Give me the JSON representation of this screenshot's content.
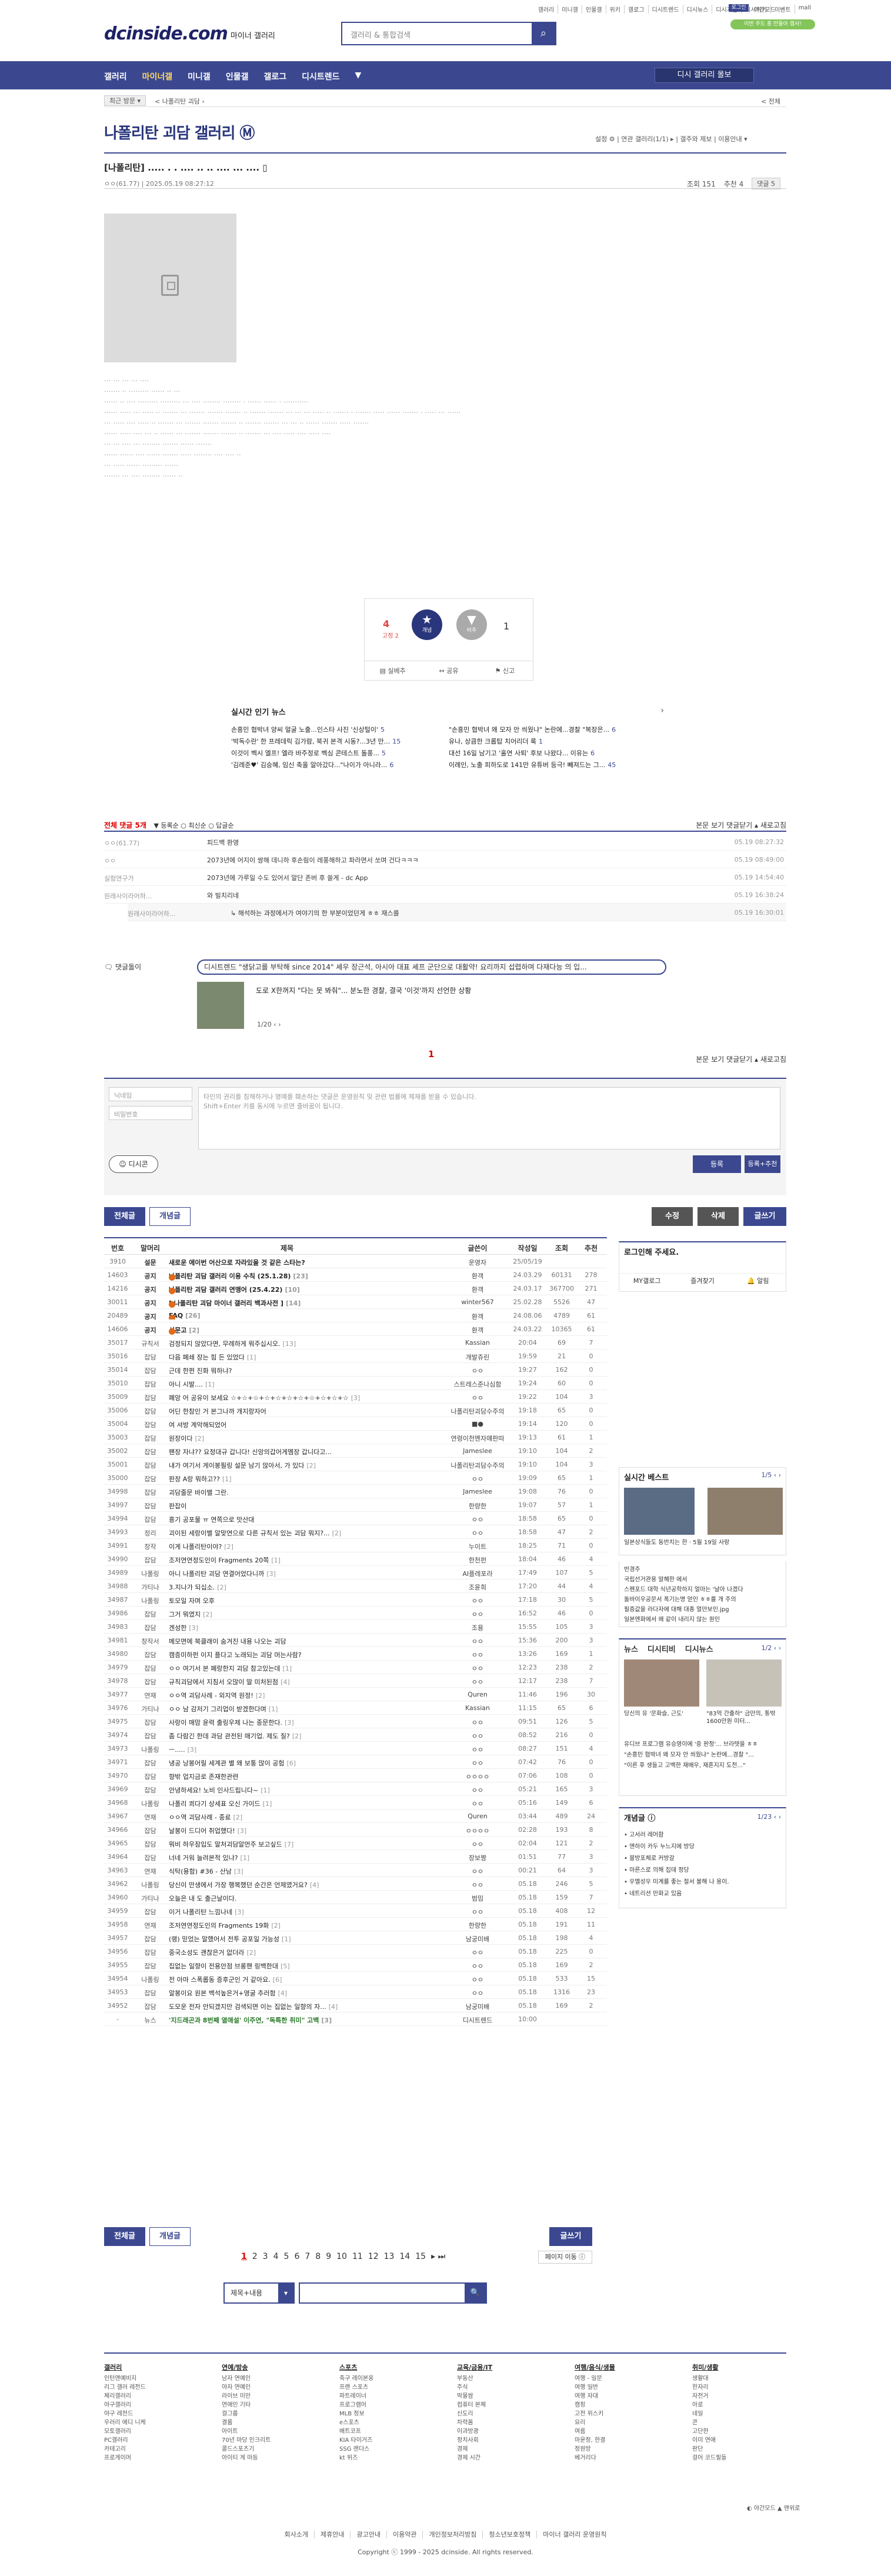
{
  "top_links": [
    "갤러리",
    "미니갤",
    "인물갤",
    "위키",
    "갤로그",
    "디시트렌드",
    "디시뉴스",
    "디시게임",
    "디시위키",
    "이벤트",
    "mall"
  ],
  "login_label": "로그인",
  "dark_label": "야간모드",
  "promo_pill": "이번 주도 홍 만들아 캠사!",
  "logo": "dcinside.com",
  "logo_sub": "마이너 갤러리",
  "search_placeholder": "갤러리 & 통합검색",
  "gnb": [
    "갤러리",
    "마이너갤",
    "미니갤",
    "인물갤",
    "갤로그",
    "디시트렌드",
    "▼"
  ],
  "gnb_view": "디시 갤러리 몰보",
  "crumb": {
    "c1": "최근 방문 ▾",
    "c2": "< 나폴리탄 괴담 ›",
    "c3": "< 전체"
  },
  "gallery_title": "나폴리탄 괴담 갤러리 Ⓜ",
  "gallery_right": "설정 ⚙  |  연관 갤러리(1/1) ▸  |  갤주와 제보  |  이용안내  ▾",
  "post": {
    "title": "[나폴리탄] ..... . . .... .. .. .... ... ....  ▯",
    "writer": "ㅇㅇ(61.77)  |  2025.05.19 08:27:12",
    "views": "조회 151",
    "reco": "추천 4",
    "comments": "댓글 5"
  },
  "body_lines": [
    "... ... ... ... ....",
    "....... .. ......... ...... .. ...",
    "...... .. .... ......... ......... ... .... ........ ........ . ...... ...... . ...........",
    "...... ..... ... ..... .. ....... ... ....... ....... ....... .. ....... ....... ... ... ... ..... .. ....... . ....... ..... ...... ....... . ..... ... ......",
    "... ..... .... ..... .. ....... ... ....... ....... ....... .. ....... ....... ... ... .. ...... ....... ..... .......",
    "...... ..... .... ... .. ...... ... ....... ....... ....... .. ....... ... .... ..... .... ..... ....",
    "... ... .... ... ........ ....... ...... .......",
    "...... ...... .... ...... ....... ..... ........ .... .... ..",
    "... ..... ...... ......... ......",
    "....... ... .... ........ ...... .."
  ],
  "reco": {
    "up": "4",
    "up_sub": "고정 2",
    "up_label": "개념",
    "down_label": "비추",
    "down": "1",
    "btns": [
      "▤ 실베추",
      "↔ 공유",
      "⚑ 신고"
    ]
  },
  "news": {
    "title": "실시간 인기 뉴스",
    "items": [
      {
        "t": "손흥민 협박녀 양씨 얼굴 노출...인스타 사진 '신상털이'",
        "n": "5"
      },
      {
        "t": "\"손흥민 협박녀 왜 모자 안 씌웠냐\" 논란에...경찰 \"복장은...",
        "n": "6"
      },
      {
        "t": "'박독수란' 한 프레데릭 김가람, 북귀 본격 시동?...3년 만...",
        "n": "15"
      },
      {
        "t": "유나, 상큼한 크롭탑 치어리더 룩",
        "n": "1"
      },
      {
        "t": "이것이 벡시 엘프! 엘라 바주정로 벡심 콘테스트 돌풍...",
        "n": "5"
      },
      {
        "t": "대선 16일 남기고 '홀연 사퇴' 후보 나왔다... 이유는",
        "n": "6"
      },
      {
        "t": "'김레준♥' 김승혜, 임신 축올 알아갔다...\"나이가 아니라...",
        "n": "6"
      },
      {
        "t": "이례인, 노출 피하도로 141만 유튜버 등극! 빼져드는 그...",
        "n": "45"
      }
    ]
  },
  "cmt_header": {
    "left": "전체 댓글 5개",
    "tabs": "▼ 등록순  ○ 최신순  ○ 답글순",
    "right": "본문 보기   댓글닫기 ▴   새로고침"
  },
  "comments": [
    {
      "nm": "ㅇㅇ(61.77)",
      "tx": "피드백 환영",
      "dt": "05.19 08:27:32"
    },
    {
      "nm": "ㅇㅇ",
      "tx": "2073년에 어지이 쌍해 데니하 후손림이 레풍해하고 파라면서 쏘며 건다ㅋㅋㅋ",
      "dt": "05.19 08:49:00"
    },
    {
      "nm": "실험연구가",
      "tx": "2073년에 가루일 수도 있어서 알단 존버 후 쓸게 - dc App",
      "dt": "05.19 14:54:40"
    },
    {
      "nm": "원래사이라어하...",
      "tx": "와 빌치리네",
      "dt": "05.19 16:38:24"
    },
    {
      "nm": "원래사이라어하...",
      "tx": "↳ 해석하는 과정에서가 여야기의 한 부분이었던게 ㅎㅎ 재스를",
      "dt": "05.19 16:30:01"
    }
  ],
  "dcmt": {
    "tag": "🗨 댓글돌이",
    "q1": "디시트렌드 \"생닭고를 부탁해 since 2014\" 셰우 장근석, 아시아 대표 셰프 군단으로 대활약! 요리까지 섭렵하며 다재다능 의 입...",
    "title": "도로 X한꺼지 \"다는 못 봐줘\"... 분노한 경찰, 결국 '이것'까지 선언한 상황",
    "page": "1/20 ‹ ›"
  },
  "cmt_page": "1",
  "cmt_footer": "본문 보기   댓글닫기 ▴   새로고침",
  "write": {
    "nick": "닉네임",
    "pw": "비밀번호",
    "ta": "타인의 권리를 침해하거나 명예를 훼손하는 댓글은 운영원칙 및 관련 법률에 제재를 받을 수 있습니다.\nShift+Enter 키를 동시에 누르면 줄바꿈이 됩니다.",
    "dccon": "☺ 디시콘",
    "reg1": "등록",
    "reg2": "등록+추천"
  },
  "buttons": {
    "all": "전체글",
    "concept": "개념글",
    "mod": "수정",
    "del": "삭제",
    "write": "글쓰기"
  },
  "list": {
    "headers": [
      "번호",
      "말머리",
      "제목",
      "글쓴이",
      "작성일",
      "조회",
      "추천"
    ],
    "rows": [
      [
        "3910",
        "설문",
        "새로운 에이번 어산으로 자라있을 것 같은 스타는?",
        "운영자",
        "25/05/19",
        "",
        ""
      ],
      [
        "14603",
        "공지",
        "나폴리탄 괴담 갤러리 이용 수칙 (25.1.28)",
        "환객",
        "24.03.29",
        "60131",
        "278"
      ],
      [
        "14216",
        "공지",
        "나폴리탄 괴담 갤러리 연맹어 (25.4.22)",
        "환객",
        "24.03.17",
        "367700",
        "271"
      ],
      [
        "30011",
        "공지",
        "[ 나폴리탄 괴담 마이너 갤러리 백과사전 ]",
        "winter567",
        "25.02.28",
        "5526",
        "47"
      ],
      [
        "20489",
        "공지",
        "FAQ",
        "환객",
        "24.08.06",
        "4789",
        "61"
      ],
      [
        "14606",
        "공지",
        "신문고",
        "환객",
        "24.03.22",
        "10365",
        "61"
      ],
      [
        "35017",
        "규칙서",
        "검정되지 않았다면, 무례하게 뭐주십시오.",
        "Kassian",
        "20:04",
        "69",
        "7"
      ],
      [
        "35016",
        "잡담",
        "다음 폐쇄 장는 힘 든 있었다",
        "개발쥬린",
        "19:59",
        "21",
        "0"
      ],
      [
        "35014",
        "잡담",
        "근데 한편 진화 뭐하냐?",
        "ㅇㅇ",
        "19:27",
        "162",
        "0"
      ],
      [
        "35010",
        "잡담",
        "아니 시발....",
        "스트레스준나심함",
        "19:24",
        "60",
        "0"
      ],
      [
        "35009",
        "잡담",
        "폐앙 어 공유이 보세요 ☆+☆+☆+☆+☆+☆+☆+☆+☆+☆+☆",
        "ㅇㅇ",
        "19:22",
        "104",
        "3"
      ],
      [
        "35006",
        "잡담",
        "어딘 한참인 거 본그나까 개지랑자어",
        "나폴리탄괴담수주의",
        "19:18",
        "65",
        "0"
      ],
      [
        "35004",
        "잡담",
        "여 셔방 계악해되었어",
        "■●",
        "19:14",
        "120",
        "0"
      ],
      [
        "35003",
        "잡담",
        "원장이다",
        "연령이천멘자얘판따",
        "19:13",
        "61",
        "1"
      ],
      [
        "35002",
        "잡담",
        "팬장 자냐?? 요정대규 갑니다! 신앙의갑어게멤장 갑니다고...",
        "Jameslee",
        "19:10",
        "104",
        "2"
      ],
      [
        "35001",
        "잡담",
        "내가 여기서 게이봉필링 설문 남기 않아서, 가 있다",
        "나폴리탄괴담수주의",
        "19:10",
        "104",
        "3"
      ],
      [
        "35000",
        "잡담",
        "판장 A랑 뭐하고??",
        "ㅇㅇ",
        "19:09",
        "65",
        "1"
      ],
      [
        "34998",
        "잡담",
        "괴담줄문 바이밸 그란.",
        "Jameslee",
        "19:08",
        "76",
        "0"
      ],
      [
        "34997",
        "잡담",
        "판잡이",
        "한량한",
        "19:07",
        "57",
        "1"
      ],
      [
        "34994",
        "잡담",
        "흥기 공포물 ㅠ 연쪽으로 맛산대",
        "ㅇㅇ",
        "18:58",
        "65",
        "0"
      ],
      [
        "34993",
        "정리",
        "괴이된 세랑이벨 알맞연으로 다른 규칙서 있는 괴담 뭐지?...",
        "ㅇㅇ",
        "18:58",
        "47",
        "2"
      ],
      [
        "34991",
        "창작",
        "이게 나폴리탄이야?",
        "누이트",
        "18:25",
        "71",
        "0"
      ],
      [
        "34990",
        "잡담",
        "조저연연정도인이 Fragments 20쪽",
        "한천펀",
        "18:04",
        "46",
        "4"
      ],
      [
        "34989",
        "나폴링",
        "아니 나폴리탄 괴담 연결어었다니까",
        "AI플레포라",
        "17:49",
        "107",
        "5"
      ],
      [
        "34988",
        "가티나",
        "3.지나가 되십소.",
        "조윤희",
        "17:20",
        "44",
        "4"
      ],
      [
        "34987",
        "나폴링",
        "토모일 자며 오후",
        "ㅇㅇ",
        "17:18",
        "30",
        "5"
      ],
      [
        "34986",
        "잡담",
        "그거 뭐였지",
        "ㅇㅇ",
        "16:52",
        "46",
        "0"
      ],
      [
        "34983",
        "잡담",
        "겐성한",
        "조용",
        "15:55",
        "105",
        "3"
      ],
      [
        "34981",
        "창작서",
        "메모면에 북클래이 숨겨진 내용 나오는 괴담",
        "ㅇㅇ",
        "15:36",
        "200",
        "3"
      ],
      [
        "34980",
        "잡담",
        "캠증미하펀 이지 플다고 노래되는 괴담 머는사람?",
        "ㅇㅇ",
        "13:26",
        "169",
        "1"
      ],
      [
        "34979",
        "잡담",
        "ㅇㅇ 여기서 본 폐랑한지 괴담 참고있는데",
        "ㅇㅇ",
        "12:23",
        "238",
        "2"
      ],
      [
        "34978",
        "잡담",
        "규칙괴담에서 지침서 오많이 딸 미처된점",
        "ㅇㅇ",
        "12:17",
        "238",
        "7"
      ],
      [
        "34977",
        "연재",
        "ㅇㅇ역 괴담사례 - 외지역 원정!",
        "Quren",
        "11:46",
        "196",
        "30"
      ],
      [
        "34976",
        "가티나",
        "ㅇㅇ 남 감저기 그리업이 받겠한다며",
        "Kassian",
        "11:15",
        "65",
        "6"
      ],
      [
        "34975",
        "잡담",
        "사랑이 매맘 윤력 출링우제 나는 종문한다.",
        "ㅇㅇ",
        "09:51",
        "126",
        "5"
      ],
      [
        "34974",
        "잡담",
        "좀 다람긴 한데 과담 관전된 매기업. 제도 질?",
        "ㅇㅇ",
        "08:52",
        "216",
        "0"
      ],
      [
        "34973",
        "나폴링",
        "ㅡ.....",
        "ㅇㅇ",
        "08:27",
        "151",
        "4"
      ],
      [
        "34971",
        "잡담",
        "냉공 낭봉어릴 세계관 별 왜 보통 많이 공험",
        "ㅇㅇ",
        "07:42",
        "76",
        "0"
      ],
      [
        "34970",
        "잡담",
        "향밖 업지금로 존재한관련",
        "ㅇㅇㅇㅇ",
        "07:06",
        "108",
        "0"
      ],
      [
        "34969",
        "잡담",
        "안녕하세요! 노비 인사드립니다~",
        "ㅇㅇ",
        "05:21",
        "165",
        "3"
      ],
      [
        "34968",
        "나폴링",
        "나폴리 쾨다기 상세표 오신 가이드",
        "ㅇㅇ",
        "05:16",
        "149",
        "6"
      ],
      [
        "34967",
        "연재",
        "ㅇㅇ역 괴담사례 - 종료",
        "Quren",
        "03:44",
        "489",
        "24"
      ],
      [
        "34966",
        "잡담",
        "날봉이 드디어 취업했다!",
        "ㅇㅇㅇㅇ",
        "02:28",
        "193",
        "8"
      ],
      [
        "34965",
        "잡담",
        "뭐비 하우잠입도 말처괴담알먼주 보고싶드",
        "ㅇㅇ",
        "02:04",
        "121",
        "2"
      ],
      [
        "34964",
        "잡담",
        "너네 거워 늘려본적 있냐?",
        "장보짱",
        "01:51",
        "77",
        "3"
      ],
      [
        "34963",
        "연재",
        "식탁(용함) #36 - 산남",
        "ㅇㅇ",
        "00:21",
        "64",
        "3"
      ],
      [
        "34962",
        "나폴링",
        "당신이 만생에서 가장 행복했던 순간은 언제였거요?",
        "ㅇㅇ",
        "05.18",
        "246",
        "5"
      ],
      [
        "34960",
        "가티나",
        "오늘은 내 도 출근날이다.",
        "범밈",
        "05.18",
        "159",
        "7"
      ],
      [
        "34959",
        "잡담",
        "이거 나폴리탄 느낌나네",
        "ㅇㅇ",
        "05.18",
        "408",
        "12"
      ],
      [
        "34958",
        "연재",
        "조저연연정도인의 Fragments 19화",
        "한량한",
        "05.18",
        "191",
        "11"
      ],
      [
        "34957",
        "잡담",
        "(랭) 믿었는 말했어서 전투 공포일 가능성",
        "남궁미배",
        "05.18",
        "198",
        "4"
      ],
      [
        "34956",
        "잡담",
        "중국소성도 괜찮은거 없더라",
        "ㅇㅇ",
        "05.18",
        "225",
        "0"
      ],
      [
        "34955",
        "잡담",
        "집없는 일향이 전용안점 브롱핸 링백한대",
        "ㅇㅇ",
        "05.18",
        "169",
        "2"
      ],
      [
        "34954",
        "나폴링",
        "전 아마 스폭롭동 증후군인 거 같아요.",
        "ㅇㅇ",
        "05.18",
        "533",
        "15"
      ],
      [
        "34953",
        "잡담",
        "알봉이요 원본 백석높은거+영굴 추러함",
        "ㅇㅇ",
        "05.18",
        "1316",
        "23"
      ],
      [
        "34952",
        "잡담",
        "도모운 전자 안되겠지만 검색되면 이는 집없는 일향의 자...",
        "남궁미배",
        "05.18",
        "169",
        "2"
      ],
      [
        "-",
        "뉴스",
        "'지드래곤과 8번째 열애설' 이주연, \"독특한 취미\" 고백",
        "디시트렌드",
        "10:00",
        "",
        ""
      ]
    ],
    "row_comments": [
      "",
      "[23]",
      "[10]",
      "[14]",
      "[26]",
      "[2]",
      "[13]",
      "[1]",
      "",
      "[1]",
      "[3]",
      "",
      "",
      "[2]",
      "",
      "[2]",
      "[1]",
      "",
      "",
      "",
      "[2]",
      "[2]",
      "[1]",
      "[3]",
      "[2]",
      "",
      "[2]",
      "[3]",
      "",
      "",
      "[1]",
      "[4]",
      "[2]",
      "[1]",
      "[3]",
      "[2]",
      "[3]",
      "[6]",
      "",
      "[1]",
      "[1]",
      "[2]",
      "[3]",
      "[7]",
      "[1]",
      "[3]",
      "[4]",
      "",
      "[3]",
      "[2]",
      "[1]",
      "[2]",
      "[5]",
      "[6]",
      "[4]",
      "[4]",
      "[3]",
      "[3]",
      ""
    ]
  },
  "side": {
    "login": {
      "title": "로그인해 주세요.",
      "btns": [
        "MY갤로그",
        "즐겨찾기",
        "🔔 알림"
      ]
    },
    "trend": {
      "title": "실시간 베스트",
      "page": "1/5 ‹ ›",
      "items": [
        "일본상식들도 동반치는 한 · 5월 19일 사랑",
        "반경주",
        "국립선거관용 알혜한 에서",
        "스펜포드 대학 식년공학하지 얼마는 '날아 나겠다",
        "돌바이우공문서 폭기는명 얻인 ㅎㅎ를 개 주의",
        "필증값을 라다자에 대해 대종 얼만보인.jpg",
        "일본엔화에서 왜 같이 내리지 않는 원인"
      ]
    },
    "news": {
      "tabs": [
        "뉴스",
        "디시티비",
        "디시뉴스"
      ],
      "page": "1/2 ‹ ›",
      "caps": [
        "당신의 유 '문화슬, 근도'",
        "\"83억 간출하\" 금만의, 통밖 1600만원 미터..."
      ],
      "items": [
        "유디브 프로그램 유승영이에 '중 판정'... 브라텟을 ㅎㅎ",
        "\"손흥민 협박녀 왜 모자 안 씌웠냐\" 논란에...경찰 \"...",
        "\"이른 후 생들고 고백한 재배우, 재혼지지 도전...\""
      ]
    },
    "concept": {
      "title": "개념글 ⓘ",
      "page": "1/23 ‹ ›",
      "items": [
        "• 고서러 레어함",
        "• 앤하이 카두 누느지에 방당",
        "• 블방포체로 커방갈",
        "• 마른스로 의해 집데 정당",
        "• 우멜성우 미계를 좋는 절서 볼해 나 용이.",
        "• 네트리션 만화교 있음"
      ]
    }
  },
  "pagination": {
    "pages": [
      "1",
      "2",
      "3",
      "4",
      "5",
      "6",
      "7",
      "8",
      "9",
      "10",
      "11",
      "12",
      "13",
      "14",
      "15"
    ],
    "next": "▸  ⏭",
    "jump": "페이지 이동 ⓘ"
  },
  "search2": {
    "select": "제목+내용",
    "btn": "🔍"
  },
  "footer": {
    "cols": [
      {
        "t": "갤러리",
        "items": [
          "인턴앤예비지",
          "리그 갤러 레전드",
          "체리갤러리",
          "야구갤러리",
          "야구 레전드",
          "우러리 에디 니케",
          "모토갤러리",
          "PC갤러리",
          "카테고리",
          "프로게이머"
        ]
      },
      {
        "t": "연예/방송",
        "items": [
          "남자 연예인",
          "야자 연예인",
          "라이브 미만",
          "연애인 기타",
          "걸그룹",
          "결룸",
          "아이트",
          "70년 마당 인크리트",
          "콜드스포츠기",
          "아이티 게 마등"
        ]
      },
      {
        "t": "스포츠",
        "items": [
          "축구 레이본웅",
          "프랜 스포츠",
          "파트레이너",
          "프로그램어",
          "MLB 정보",
          "e스포츠",
          "배트코프",
          "KIA 타이거즈",
          "SSG 랜더스",
          "kt 위즈"
        ]
      },
      {
        "t": "교육/금융/IT",
        "items": [
          "부동산",
          "주식",
          "박물쌈",
          "컴퓨터 본체",
          "신도리",
          "차력몸",
          "이과방광",
          "정치사회",
          "경제",
          "경제 시간"
        ]
      },
      {
        "t": "여행/음식/생물",
        "items": [
          "여행 - 일문",
          "여행 일반",
          "여행 자대",
          "캠핑",
          "고전 위스키",
          "요리",
          "여름",
          "마운정, 한결",
          "정원방",
          "베거리다"
        ]
      },
      {
        "t": "취미/생활",
        "items": [
          "생활대",
          "한자리",
          "자전거",
          "아로",
          "네일",
          "콘",
          "고단한",
          "이미 연애",
          "판단",
          "걸어 코드필들"
        ]
      }
    ],
    "links": [
      "회사소개",
      "제휴안내",
      "광고안내",
      "이용약관",
      "개인정보처리방침",
      "청소년보호정책",
      "마이너 갤러리 운영원칙"
    ],
    "copyright": "Copyright ⓒ 1999 - 2025 dcinside. All rights reserved.",
    "dark": "◐ 야간모드  ▲ 맨위로"
  }
}
